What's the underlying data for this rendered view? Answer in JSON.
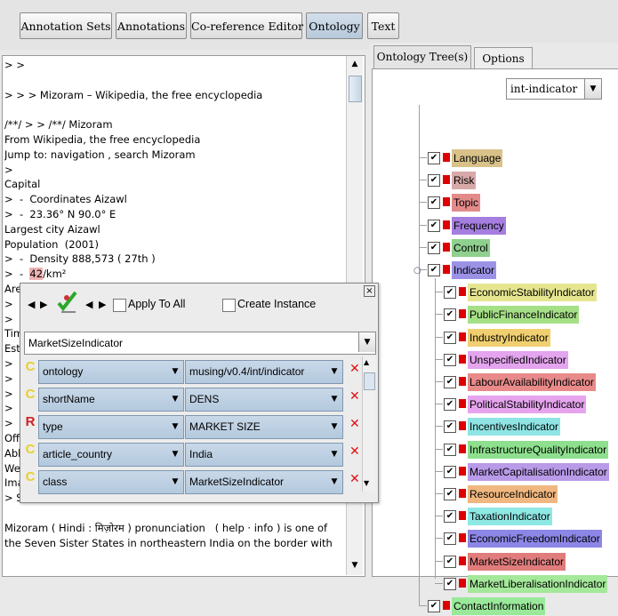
{
  "toolbar": {
    "buttons": [
      "Annotation Sets",
      "Annotations",
      "Co-reference Editor",
      "Ontology",
      "Text"
    ]
  },
  "document": {
    "lines": [
      "> >",
      "",
      "> > > Mizoram – Wikipedia, the free encyclopedia",
      "",
      "/**/ > > /**/ Mizoram",
      "From Wikipedia, the free encyclopedia",
      "Jump to: navigation , search Mizoram",
      ">",
      "Capital",
      ">  -  Coordinates Aizawl",
      ">  -  23.36° N 90.0° E",
      "Largest city Aizawl",
      "Population  (2001)",
      ">  -  Density 888,573 ( 27th )",
      ">  -  ",
      "Area",
      ">  -",
      ">  -",
      "Time",
      "Estab",
      ">  -",
      ">  -",
      ">  -",
      ">  -",
      ">  -",
      "Offici",
      "Abbr",
      "Webs",
      "Image:Mizoram.png",
      "> Seal of Mizoram",
      "",
      "Mizoram ( Hindi : मिज़ोरम ) pronunciation   ( help · info ) is one of",
      "the Seven Sister States in northeastern India on the border with"
    ],
    "highlight": "42",
    "after_highlight": "/km²"
  },
  "right": {
    "tabs": [
      "Ontology Tree(s)",
      "Options"
    ],
    "ontology_select": "int-indicator",
    "tree": [
      {
        "label": "Language",
        "color": "#d9c28a",
        "level": 0
      },
      {
        "label": "Risk",
        "color": "#d8a9a9",
        "level": 0
      },
      {
        "label": "Topic",
        "color": "#e38a8a",
        "level": 0
      },
      {
        "label": "Frequency",
        "color": "#a57ee0",
        "level": 0
      },
      {
        "label": "Control",
        "color": "#8fd08f",
        "level": 0
      },
      {
        "label": "Indicator",
        "color": "#9b92e6",
        "level": 0
      },
      {
        "label": "EconomicStabilityIndicator",
        "color": "#e6e690",
        "level": 1
      },
      {
        "label": "PublicFinanceIndicator",
        "color": "#a6e086",
        "level": 1
      },
      {
        "label": "IndustryIndicator",
        "color": "#f0cf70",
        "level": 1
      },
      {
        "label": "UnspecifiedIndicator",
        "color": "#e4a4ee",
        "level": 1
      },
      {
        "label": "LabourAvailabilityIndicator",
        "color": "#e88a8a",
        "level": 1
      },
      {
        "label": "PoliticalStabilityIndicator",
        "color": "#e6a4ee",
        "level": 1
      },
      {
        "label": "IncentivesIndicator",
        "color": "#8fe4e4",
        "level": 1
      },
      {
        "label": "InfrastructureQualityIndicator",
        "color": "#8ee08e",
        "level": 1
      },
      {
        "label": "MarketCapitalisationIndicator",
        "color": "#b99ae8",
        "level": 1
      },
      {
        "label": "ResourceIndicator",
        "color": "#f0b880",
        "level": 1
      },
      {
        "label": "TaxationIndicator",
        "color": "#8ee8e4",
        "level": 1
      },
      {
        "label": "EconomicFreedomIndicator",
        "color": "#8c86e6",
        "level": 1
      },
      {
        "label": "MarketSizeIndicator",
        "color": "#e07c7c",
        "level": 1
      },
      {
        "label": "MarketLiberalisationIndicator",
        "color": "#a4e89a",
        "level": 1
      },
      {
        "label": "ContactInformation",
        "color": "#9ae89a",
        "level": 0
      }
    ]
  },
  "popup": {
    "apply_to_all": "Apply To All",
    "create_instance": "Create Instance",
    "type_value": "MarketSizeIndicator",
    "features": [
      {
        "flag": "C",
        "name": "ontology",
        "value": "musing/v0.4/int/indicator"
      },
      {
        "flag": "C",
        "name": "shortName",
        "value": "DENS"
      },
      {
        "flag": "R",
        "name": "type",
        "value": "MARKET SIZE"
      },
      {
        "flag": "C",
        "name": "article_country",
        "value": "India"
      },
      {
        "flag": "C",
        "name": "class",
        "value": "MarketSizeIndicator"
      }
    ]
  },
  "colors": {
    "accent_selected_button": "#b6c8da",
    "delete_icon": "#e01010",
    "tree_square": "#dd0000"
  }
}
